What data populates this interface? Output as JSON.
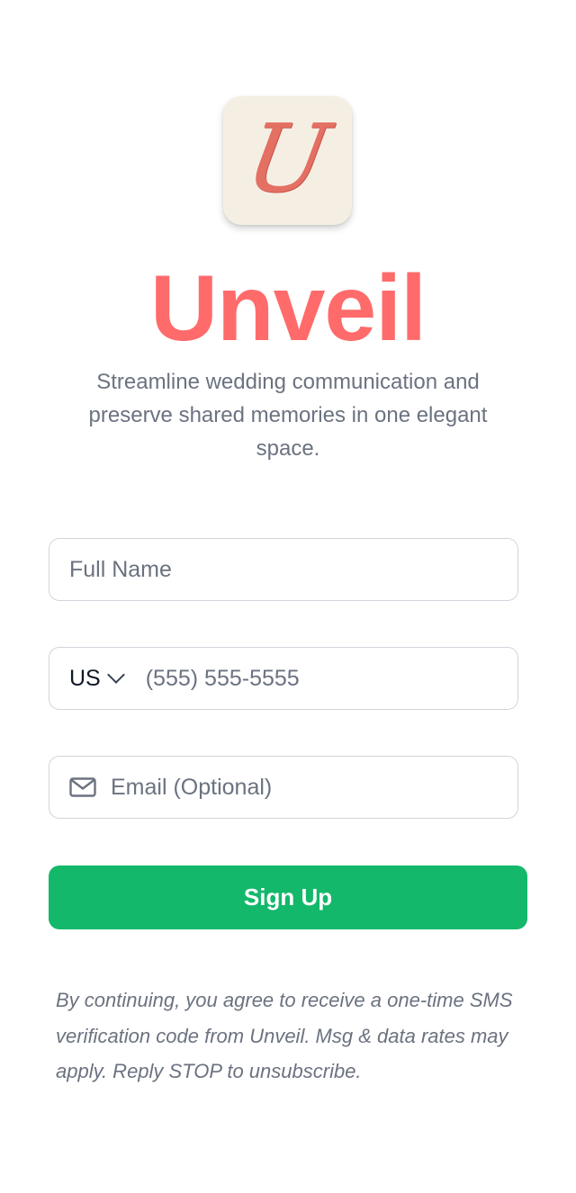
{
  "app": {
    "logo_letter": "U",
    "title": "Unveil",
    "tagline": "Streamline wedding communication and preserve shared memories in one elegant space."
  },
  "form": {
    "full_name": {
      "value": "",
      "placeholder": "Full Name"
    },
    "phone": {
      "country_code": "US",
      "value": "",
      "placeholder": "(555) 555-5555"
    },
    "email": {
      "icon": "mail-icon",
      "value": "",
      "placeholder": "Email (Optional)"
    },
    "signup_label": "Sign Up"
  },
  "disclaimer": "By continuing, you agree to receive a one-time SMS verification code from Unveil. Msg & data rates may apply. Reply STOP to unsubscribe.",
  "colors": {
    "brand": "#ff6b6b",
    "button": "#13b86b",
    "logo_bg": "#f5efe3"
  }
}
